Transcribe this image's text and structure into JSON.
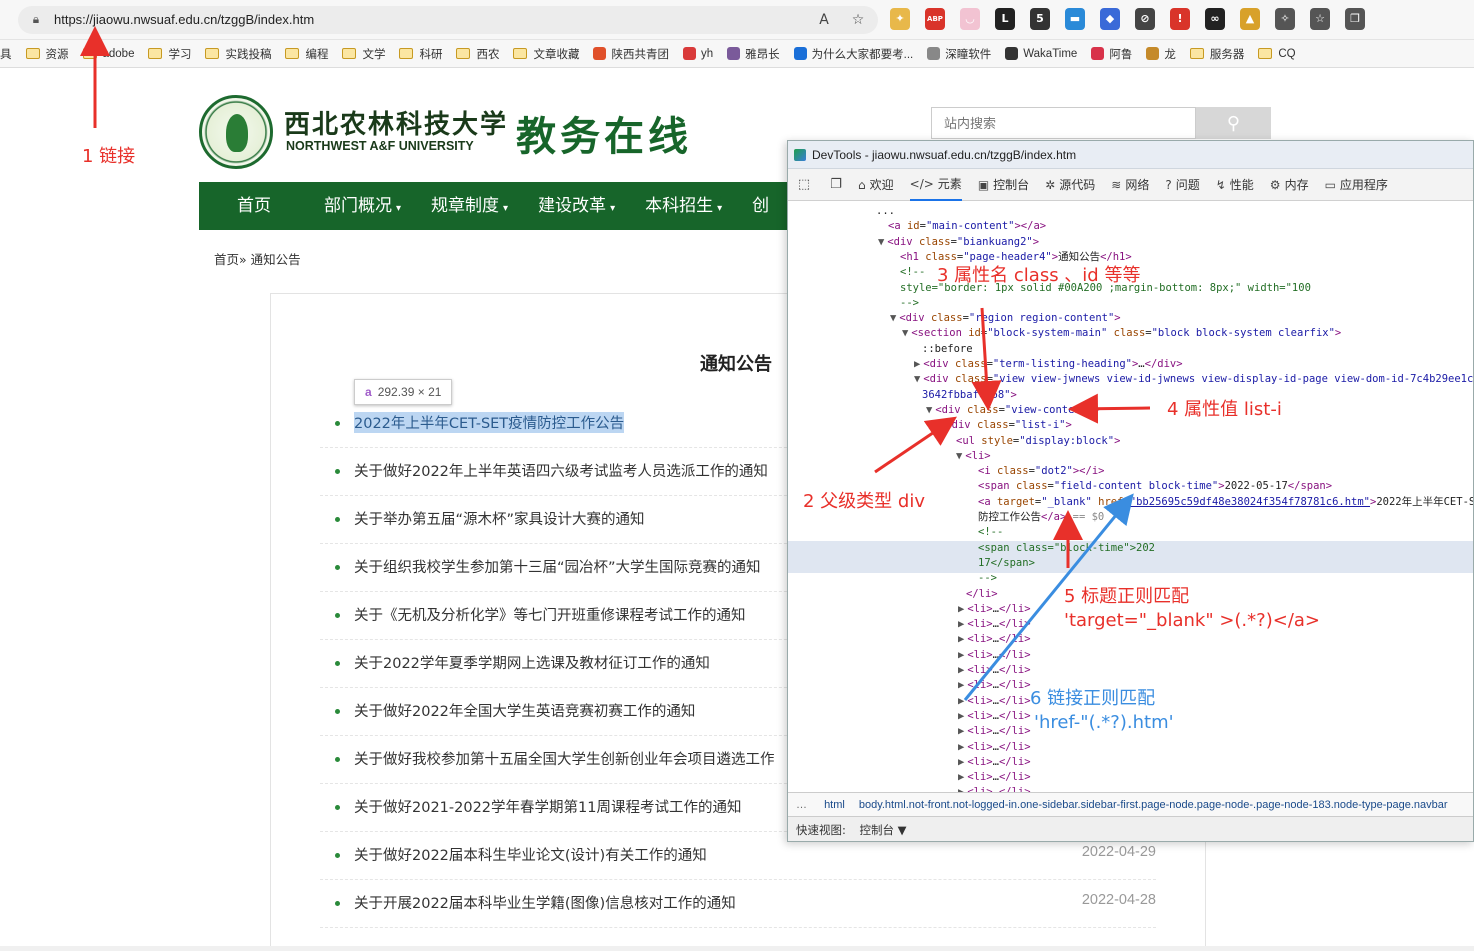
{
  "browser": {
    "url": "https://jiaowu.nwsuaf.edu.cn/tzggB/index.htm",
    "bookmarks": [
      {
        "label": "具",
        "type": "text"
      },
      {
        "label": "资源",
        "type": "folder"
      },
      {
        "label": "adobe",
        "type": "folder"
      },
      {
        "label": "学习",
        "type": "folder"
      },
      {
        "label": "实践投稿",
        "type": "folder"
      },
      {
        "label": "编程",
        "type": "folder"
      },
      {
        "label": "文学",
        "type": "folder"
      },
      {
        "label": "科研",
        "type": "folder"
      },
      {
        "label": "西农",
        "type": "folder"
      },
      {
        "label": "文章收藏",
        "type": "folder"
      },
      {
        "label": "陕西共青团",
        "type": "site",
        "color": "#e0502a"
      },
      {
        "label": "yh",
        "type": "site",
        "color": "#d93a3a"
      },
      {
        "label": "雅昂长",
        "type": "site",
        "color": "#7a5a9a"
      },
      {
        "label": "为什么大家都要考...",
        "type": "site",
        "color": "#1a6fd8"
      },
      {
        "label": "深瞳软件",
        "type": "site",
        "color": "#888888"
      },
      {
        "label": "WakaTime",
        "type": "site",
        "color": "#333333"
      },
      {
        "label": "阿鲁",
        "type": "site",
        "color": "#d8324a"
      },
      {
        "label": "龙",
        "type": "site",
        "color": "#c58a2a"
      },
      {
        "label": "服务器",
        "type": "folder"
      },
      {
        "label": "CQ",
        "type": "folder"
      }
    ],
    "extensions": [
      {
        "name": "bird-icon",
        "color": "#e8b84a",
        "glyph": "✦"
      },
      {
        "name": "abp-icon",
        "color": "#d9342a",
        "glyph": "ABP"
      },
      {
        "name": "cat-icon",
        "color": "#f2c3d2",
        "glyph": "◡"
      },
      {
        "name": "tag-icon",
        "color": "#222222",
        "glyph": "L"
      },
      {
        "name": "badge-ext-icon",
        "color": "#333333",
        "glyph": "5"
      },
      {
        "name": "bar-ext-icon",
        "color": "#2a8ad8",
        "glyph": "▬"
      },
      {
        "name": "shield-ext-icon",
        "color": "#3a6ad8",
        "glyph": "◆"
      },
      {
        "name": "block-icon",
        "color": "#444444",
        "glyph": "⊘"
      },
      {
        "name": "alert-icon",
        "color": "#d9342a",
        "glyph": "!"
      },
      {
        "name": "glasses-icon",
        "color": "#222222",
        "glyph": "∞"
      },
      {
        "name": "chart-ext-icon",
        "color": "#d8a12a",
        "glyph": "▲"
      },
      {
        "name": "puzzle-icon",
        "color": "#555555",
        "glyph": "✧"
      },
      {
        "name": "favorites-icon",
        "color": "#555555",
        "glyph": "☆"
      },
      {
        "name": "collections-icon",
        "color": "#555555",
        "glyph": "❐"
      }
    ]
  },
  "site": {
    "uni_cn": "西北农林科技大学",
    "uni_en": "NORTHWEST A&F UNIVERSITY",
    "title": "教务在线",
    "search_placeholder": "站内搜索",
    "nav": [
      {
        "label": "首页",
        "caret": false
      },
      {
        "label": "部门概况",
        "caret": true
      },
      {
        "label": "规章制度",
        "caret": true
      },
      {
        "label": "建设改革",
        "caret": true
      },
      {
        "label": "本科招生",
        "caret": true
      },
      {
        "label": "创",
        "caret": false
      }
    ],
    "breadcrumb": "首页» 通知公告",
    "notice_title": "通知公告",
    "tooltip": {
      "tag": "a",
      "size": "292.39 × 21"
    },
    "news": [
      {
        "title": "2022年上半年CET-SET疫情防控工作公告",
        "date": "",
        "highlighted": true
      },
      {
        "title": "关于做好2022年上半年英语四六级考试监考人员选派工作的通知",
        "date": ""
      },
      {
        "title": "关于举办第五届“源木杯”家具设计大赛的通知",
        "date": ""
      },
      {
        "title": "关于组织我校学生参加第十三届“园冶杯”大学生国际竞赛的通知",
        "date": ""
      },
      {
        "title": "关于《无机及分析化学》等七门开班重修课程考试工作的通知",
        "date": ""
      },
      {
        "title": "关于2022学年夏季学期网上选课及教材征订工作的通知",
        "date": ""
      },
      {
        "title": "关于做好2022年全国大学生英语竞赛初赛工作的通知",
        "date": ""
      },
      {
        "title": "关于做好我校参加第十五届全国大学生创新创业年会项目遴选工作",
        "date": ""
      },
      {
        "title": "关于做好2021-2022学年春学期第11周课程考试工作的通知",
        "date": ""
      },
      {
        "title": "关于做好2022届本科生毕业论文(设计)有关工作的通知",
        "date": "2022-04-29"
      },
      {
        "title": "关于开展2022届本科毕业生学籍(图像)信息核对工作的通知",
        "date": "2022-04-28"
      }
    ]
  },
  "devtools": {
    "title": "DevTools - jiaowu.nwsuaf.edu.cn/tzggB/index.htm",
    "tabs": [
      "欢迎",
      "元素",
      "控制台",
      "源代码",
      "网络",
      "问题",
      "性能",
      "内存",
      "应用程序"
    ],
    "dom_lines": [
      {
        "indent": 88,
        "html": "<span class='tx'>...</span>"
      },
      {
        "indent": 100,
        "html": "<span class='tg'>&lt;a</span> <span class='at'>id</span>=<span class='av'>\"main-content\"</span><span class='tg'>&gt;&lt;/a&gt;</span>"
      },
      {
        "indent": 90,
        "html": "<span class='tri'>▼</span><span class='tg'>&lt;div</span> <span class='at'>class</span>=<span class='av'>\"biankuang2\"</span><span class='tg'>&gt;</span>"
      },
      {
        "indent": 112,
        "html": "<span class='tg'>&lt;h1</span> <span class='at'>class</span>=<span class='av'>\"page-header4\"</span><span class='tg'>&gt;</span>通知公告<span class='tg'>&lt;/h1&gt;</span>"
      },
      {
        "indent": 112,
        "html": "<span class='cm'>&lt;!--</span>"
      },
      {
        "indent": 112,
        "html": "<span class='cm'>                                            style=\"border: 1px solid #00A200 ;margin-bottom: 8px;\" width=\"100</span>"
      },
      {
        "indent": 112,
        "html": "<span class='cm'>                                                      --&gt;</span>"
      },
      {
        "indent": 102,
        "html": "<span class='tri'>▼</span><span class='tg'>&lt;div</span> <span class='at'>class</span>=<span class='av'>\"region region-content\"</span><span class='tg'>&gt;</span>"
      },
      {
        "indent": 114,
        "html": "<span class='tri'>▼</span><span class='tg'>&lt;section</span> <span class='at'>id</span>=<span class='av'>\"block-system-main\"</span> <span class='at'>class</span>=<span class='av'>\"block block-system clearfix\"</span><span class='tg'>&gt;</span>"
      },
      {
        "indent": 134,
        "html": "<span class='tx'>::before</span>"
      },
      {
        "indent": 126,
        "html": "<span class='tri'>▶</span><span class='tg'>&lt;div</span> <span class='at'>class</span>=<span class='av'>\"term-listing-heading\"</span><span class='tg'>&gt;</span>…<span class='tg'>&lt;/div&gt;</span>"
      },
      {
        "indent": 126,
        "html": "<span class='tri'>▼</span><span class='tg'>&lt;div</span> <span class='at'>class</span>=<span class='av'>\"view view-jwnews view-id-jwnews view-display-id-page view-dom-id-7c4b29ee1cc9</span>"
      },
      {
        "indent": 134,
        "html": "<span class='av'>3642fbbaf6d68\"</span><span class='tg'>&gt;</span>"
      },
      {
        "indent": 138,
        "html": "<span class='tri'>▼</span><span class='tg'>&lt;div</span> <span class='at'>class</span>=<span class='av'>\"view-content\"</span><span class='tg'>&gt;</span>"
      },
      {
        "indent": 148,
        "html": "<span class='tri'>▼</span><span class='tg'>&lt;div</span> <span class='at'>class</span>=<span class='av'>\"list-i\"</span><span class='tg'>&gt;</span>"
      },
      {
        "indent": 168,
        "html": "<span class='tg'>&lt;ul</span> <span class='at'>style</span>=<span class='av'>\"display:block\"</span><span class='tg'>&gt;</span>"
      },
      {
        "indent": 168,
        "html": "<span class='tri'>▼</span><span class='tg'>&lt;li&gt;</span>"
      },
      {
        "indent": 190,
        "html": "<span class='tg'>&lt;i</span> <span class='at'>class</span>=<span class='av'>\"dot2\"</span><span class='tg'>&gt;&lt;/i&gt;</span>"
      },
      {
        "indent": 190,
        "html": "<span class='tg'>&lt;span</span> <span class='at'>class</span>=<span class='av'>\"field-content block-time\"</span><span class='tg'>&gt;</span>2022-05-17<span class='tg'>&lt;/span&gt;</span>"
      },
      {
        "indent": 190,
        "html": "<span class='tg'>&lt;a</span> <span class='at'>target</span>=<span class='av'>\"_blank\"</span> <span class='at'>href</span>=<span class='av' style='text-decoration:underline'>\"bb25695c59df48e38024f354f78781c6.htm\"</span><span class='tg'>&gt;</span>2022年上半年CET-SE"
      },
      {
        "indent": 190,
        "html": "防控工作公告<span class='tg'>&lt;/a&gt;</span> <span style='color:#888'>== $0</span>"
      },
      {
        "indent": 190,
        "html": "<span class='cm'>&lt;!--</span>"
      },
      {
        "indent": 190,
        "html": "<span class='cm'>                                                    &lt;span class=\"block-time\"&gt;202</span>"
      },
      {
        "indent": 190,
        "html": "<span class='cm'>17&lt;/span&gt;</span>"
      },
      {
        "indent": 190,
        "html": "<span class='cm'>                                                                  --&gt;</span>"
      },
      {
        "indent": 178,
        "html": "<span class='tg'>&lt;/li&gt;</span>"
      }
    ],
    "collapsed_li": "<li>…</li>",
    "collapsed_li_count": 13,
    "breadcrumb": [
      "html",
      "body.html.not-front.not-logged-in.one-sidebar.sidebar-first.page-node.page-node-.page-node-183.node-type-page.navbar"
    ],
    "drawer_label": "快速视图:",
    "drawer_tab": "控制台 ▼"
  },
  "annotations": {
    "a1": "1 链接",
    "a2": "2 父级类型 div",
    "a3": "3 属性名 class 、id 等等",
    "a4": "4 属性值 list-i",
    "a5_line1": "5 标题正则匹配",
    "a5_line2": "'target=\"_blank\" >(.*?)</a>",
    "a6_line1": "6 链接正则匹配",
    "a6_line2": "'href-\"(.*?).htm'"
  },
  "colors": {
    "brand_green": "#17652a",
    "annotation_red": "#e8302a",
    "annotation_blue": "#3a8de0"
  }
}
